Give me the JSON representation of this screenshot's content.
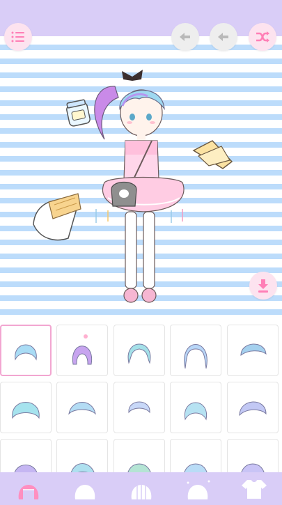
{
  "app": {
    "colors": {
      "top_bar": "#d9cdf7",
      "stripe": "#bcdcfb",
      "accent_pink": "#ff7fb6",
      "cell_border": "#e4e4e4",
      "selected_border": "#f2a6d1"
    }
  },
  "toolbar": {
    "menu_icon": "list-icon",
    "undo_icon": "undo-icon",
    "redo_icon": "redo-icon",
    "shuffle_icon": "shuffle-icon",
    "download_icon": "download-icon"
  },
  "stage": {
    "items": [
      "character",
      "jam-jar-item",
      "bread-slices-item",
      "bread-bag-item"
    ]
  },
  "hair_grid": {
    "selected_index": 0,
    "rows": 3,
    "columns": 5,
    "items": [
      "hair-style-1",
      "hair-style-2",
      "hair-style-3",
      "hair-style-4",
      "hair-style-5",
      "hair-style-6",
      "hair-style-7",
      "hair-style-8",
      "hair-style-9",
      "hair-style-10",
      "hair-style-11",
      "hair-style-12",
      "hair-style-13",
      "hair-style-14",
      "hair-style-15"
    ]
  },
  "bottom_tabs": [
    {
      "icon": "front-hair-icon",
      "active": true
    },
    {
      "icon": "back-hair-icon",
      "active": false
    },
    {
      "icon": "side-hair-icon",
      "active": false
    },
    {
      "icon": "hair-color-icon",
      "active": false
    },
    {
      "icon": "shirt-icon",
      "active": false
    }
  ]
}
